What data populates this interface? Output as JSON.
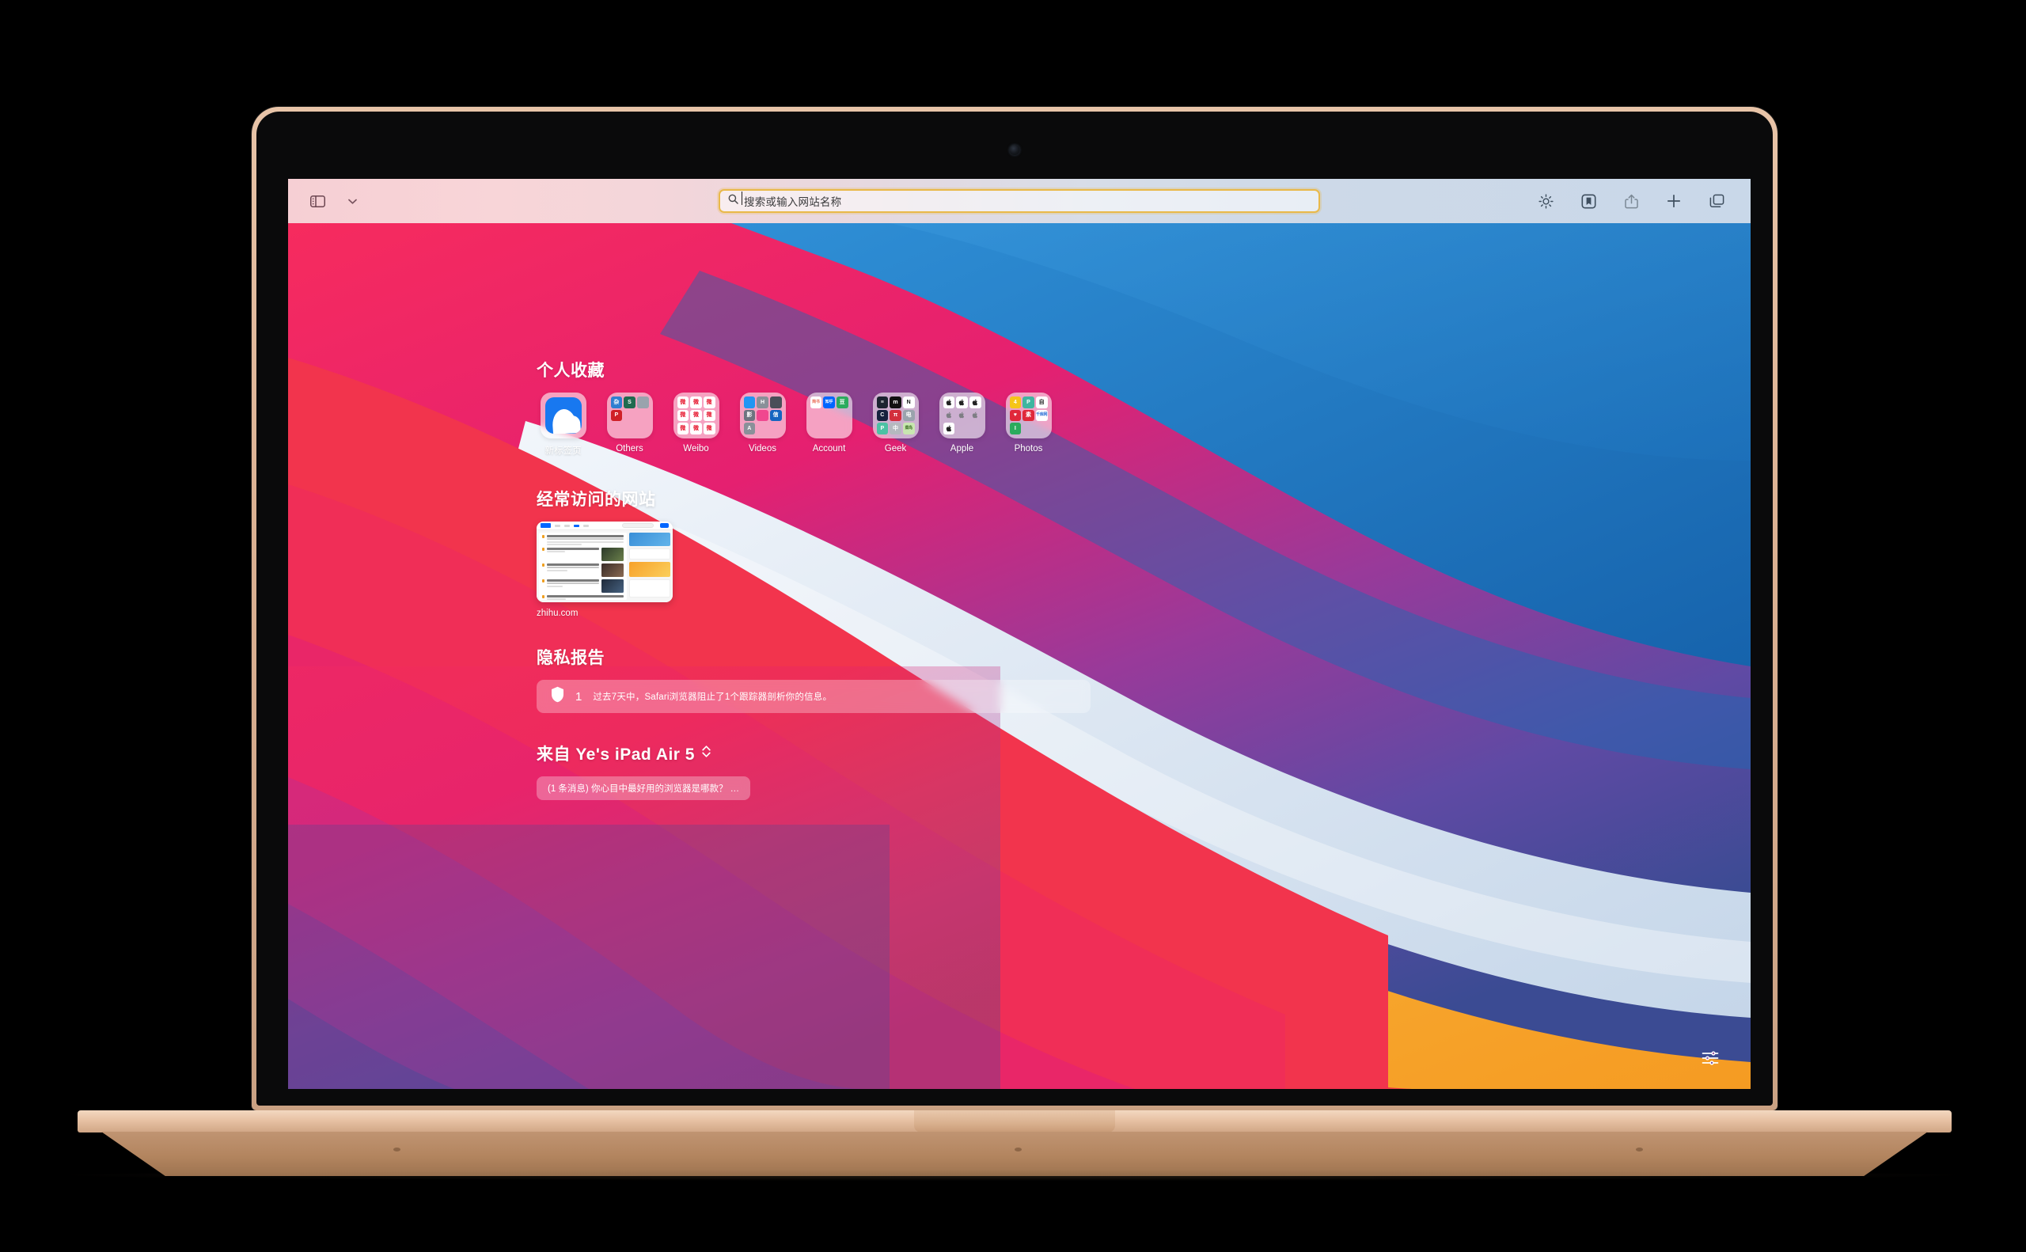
{
  "browser": {
    "name": "Safari",
    "toolbar": {
      "sidebar_toggle": "sidebar-toggle",
      "tab_group_chevron": "chevron-down",
      "address_placeholder": "搜索或输入网站名称",
      "address_value": "",
      "right_buttons": [
        {
          "name": "reader-privacy-icon",
          "label": "隐私报告"
        },
        {
          "name": "bookmark-icon",
          "label": "书签"
        },
        {
          "name": "share-icon",
          "label": "共享"
        },
        {
          "name": "new-tab-icon",
          "label": "新建标签页"
        },
        {
          "name": "tab-overview-icon",
          "label": "标签页概览"
        }
      ]
    }
  },
  "start_page": {
    "favorites": {
      "title": "个人收藏",
      "items": [
        {
          "label": "新标签页",
          "type": "single",
          "accent": "#1878f0",
          "icons": []
        },
        {
          "label": "Others",
          "type": "folder",
          "icons": [
            {
              "text": "杂",
              "bg": "#2f7fd0",
              "fg": "#ffffff"
            },
            {
              "text": "S",
              "bg": "#1f6b4f",
              "fg": "#ffffff"
            },
            {
              "text": "",
              "bg": "#9aa3ad",
              "fg": "#ffffff"
            },
            {
              "text": "P",
              "bg": "#cf2027",
              "fg": "#ffffff"
            },
            {
              "text": "",
              "bg": "transparent",
              "fg": "#ffffff"
            },
            {
              "text": "",
              "bg": "transparent",
              "fg": "#ffffff"
            },
            {
              "text": "",
              "bg": "transparent",
              "fg": "#ffffff"
            },
            {
              "text": "",
              "bg": "transparent",
              "fg": "#ffffff"
            },
            {
              "text": "",
              "bg": "transparent",
              "fg": "#ffffff"
            }
          ]
        },
        {
          "label": "Weibo",
          "type": "folder",
          "icons": [
            {
              "text": "微",
              "bg": "#ffffff",
              "fg": "#e6162d"
            },
            {
              "text": "微",
              "bg": "#ffffff",
              "fg": "#e6162d"
            },
            {
              "text": "微",
              "bg": "#ffffff",
              "fg": "#e6162d"
            },
            {
              "text": "微",
              "bg": "#ffffff",
              "fg": "#e6162d"
            },
            {
              "text": "微",
              "bg": "#ffffff",
              "fg": "#e6162d"
            },
            {
              "text": "微",
              "bg": "#ffffff",
              "fg": "#e6162d"
            },
            {
              "text": "微",
              "bg": "#ffffff",
              "fg": "#e6162d"
            },
            {
              "text": "微",
              "bg": "#ffffff",
              "fg": "#e6162d"
            },
            {
              "text": "微",
              "bg": "#ffffff",
              "fg": "#e6162d"
            }
          ]
        },
        {
          "label": "Videos",
          "type": "folder",
          "icons": [
            {
              "text": "",
              "bg": "#2196f3",
              "fg": "#ffffff"
            },
            {
              "text": "H",
              "bg": "#8a9099",
              "fg": "#ffffff"
            },
            {
              "text": "",
              "bg": "#4a4f58",
              "fg": "#ffffff"
            },
            {
              "text": "影",
              "bg": "#6e7480",
              "fg": "#ffffff"
            },
            {
              "text": "",
              "bg": "#f0478f",
              "fg": "#ffffff"
            },
            {
              "text": "信",
              "bg": "#1565c0",
              "fg": "#ffffff"
            },
            {
              "text": "A",
              "bg": "#8a9099",
              "fg": "#ffffff"
            },
            {
              "text": "",
              "bg": "transparent",
              "fg": "#ffffff"
            },
            {
              "text": "",
              "bg": "transparent",
              "fg": "#ffffff"
            }
          ]
        },
        {
          "label": "Account",
          "type": "folder",
          "icons": [
            {
              "text": "简书",
              "bg": "#ffffff",
              "fg": "#ea6f5a"
            },
            {
              "text": "知乎",
              "bg": "#0066ff",
              "fg": "#ffffff"
            },
            {
              "text": "豆",
              "bg": "#2bab5d",
              "fg": "#ffffff"
            },
            {
              "text": "",
              "bg": "transparent",
              "fg": "#ffffff"
            },
            {
              "text": "",
              "bg": "transparent",
              "fg": "#ffffff"
            },
            {
              "text": "",
              "bg": "transparent",
              "fg": "#ffffff"
            },
            {
              "text": "",
              "bg": "transparent",
              "fg": "#ffffff"
            },
            {
              "text": "",
              "bg": "transparent",
              "fg": "#ffffff"
            },
            {
              "text": "",
              "bg": "transparent",
              "fg": "#ffffff"
            }
          ]
        },
        {
          "label": "Geek",
          "type": "folder",
          "icons": [
            {
              "text": "≡",
              "bg": "#1c2430",
              "fg": "#ffffff"
            },
            {
              "text": "m",
              "bg": "#111111",
              "fg": "#ffffff"
            },
            {
              "text": "N",
              "bg": "#ffffff",
              "fg": "#111111"
            },
            {
              "text": "C",
              "bg": "#16213e",
              "fg": "#ffffff"
            },
            {
              "text": "π",
              "bg": "#d32f3c",
              "fg": "#ffffff"
            },
            {
              "text": "电",
              "bg": "#9aa3ad",
              "fg": "#ffffff"
            },
            {
              "text": "P",
              "bg": "#4cc2a4",
              "fg": "#ffffff"
            },
            {
              "text": "中",
              "bg": "#b5b9bf",
              "fg": "#ffffff"
            },
            {
              "text": "菜鸟",
              "bg": "#c8e6b0",
              "fg": "#3a6b20"
            }
          ]
        },
        {
          "label": "Apple",
          "type": "folder",
          "icons": [
            {
              "text": "apple",
              "bg": "#ffffff",
              "fg": "#222222"
            },
            {
              "text": "apple",
              "bg": "#ffffff",
              "fg": "#222222"
            },
            {
              "text": "apple",
              "bg": "#ffffff",
              "fg": "#222222"
            },
            {
              "text": "apple",
              "bg": "transparent",
              "fg": "#7e7e84"
            },
            {
              "text": "apple",
              "bg": "transparent",
              "fg": "#7e7e84"
            },
            {
              "text": "apple",
              "bg": "transparent",
              "fg": "#7e7e84"
            },
            {
              "text": "apple",
              "bg": "#ffffff",
              "fg": "#222222"
            },
            {
              "text": "",
              "bg": "transparent",
              "fg": "#ffffff"
            },
            {
              "text": "",
              "bg": "transparent",
              "fg": "#ffffff"
            }
          ]
        },
        {
          "label": "Photos",
          "type": "folder",
          "icons": [
            {
              "text": "4",
              "bg": "#f5c518",
              "fg": "#ffffff"
            },
            {
              "text": "P",
              "bg": "#3fb6a0",
              "fg": "#ffffff"
            },
            {
              "text": "自",
              "bg": "#ffffff",
              "fg": "#222222"
            },
            {
              "text": "♥",
              "bg": "#e0283a",
              "fg": "#ffffff"
            },
            {
              "text": "素",
              "bg": "#e0283a",
              "fg": "#ffffff"
            },
            {
              "text": "千库网",
              "bg": "#ffffff",
              "fg": "#2a6fd6"
            },
            {
              "text": "I",
              "bg": "#2bab5d",
              "fg": "#ffffff"
            },
            {
              "text": "",
              "bg": "transparent",
              "fg": "#ffffff"
            },
            {
              "text": "",
              "bg": "transparent",
              "fg": "#ffffff"
            }
          ]
        }
      ]
    },
    "frequently_visited": {
      "title": "经常访问的网站",
      "items": [
        {
          "label": "zhihu.com",
          "site": "知乎"
        }
      ]
    },
    "privacy_report": {
      "title": "隐私报告",
      "icon": "shield-icon",
      "count": "1",
      "text": "过去7天中，Safari浏览器阻止了1个跟踪器剖析你的信息。"
    },
    "from_device": {
      "title": "来自 Ye's iPad Air 5",
      "chevron": "chevron-updown",
      "tabs": [
        {
          "label": "(1 条消息) 你心目中最好用的浏览器是哪款？ …"
        }
      ]
    },
    "settings_button": "start-page-settings"
  },
  "device": {
    "type": "MacBook Air",
    "finish_color": "#e2bb9c"
  },
  "colors": {
    "address_bar_focus": "#e9b949",
    "wallpaper_blue": "#1a6fc0",
    "wallpaper_orange": "#f5a623",
    "wallpaper_red": "#f0434a",
    "wallpaper_pink": "#ef2272",
    "wallpaper_purple": "#7a3f9d",
    "wallpaper_deep": "#3d4a93"
  }
}
